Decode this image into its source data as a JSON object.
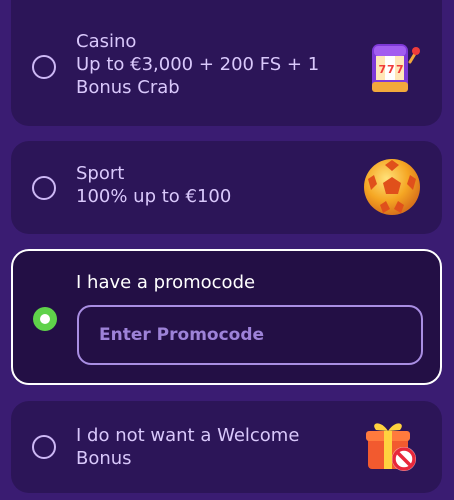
{
  "options": {
    "casino": {
      "title": "Casino",
      "description": "Up to €3,000 + 200 FS + 1 Bonus Crab",
      "icon": "slot-machine-icon",
      "selected": false
    },
    "sport": {
      "title": "Sport",
      "description": "100% up to €100",
      "icon": "soccer-ball-icon",
      "selected": false
    },
    "promo": {
      "title": "I have a promocode",
      "input_placeholder": "Enter Promocode",
      "input_value": "",
      "selected": true
    },
    "none": {
      "title": "I do not want a Welcome Bonus",
      "icon": "gift-no-icon",
      "selected": false
    }
  },
  "colors": {
    "background": "#3a1c72",
    "card": "#2c1558",
    "selected_card": "#230f45",
    "radio_checked": "#5fd24a",
    "text": "#d9c8fb",
    "input_border": "#a98ee3"
  }
}
